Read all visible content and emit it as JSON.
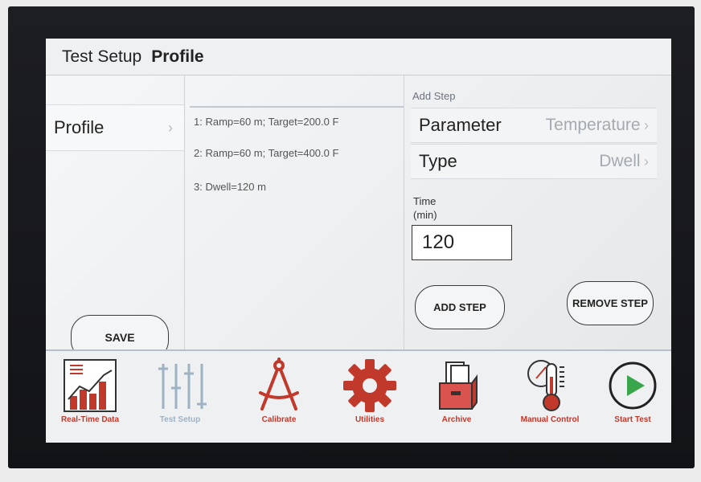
{
  "header": {
    "crumb": "Test Setup",
    "current": "Profile"
  },
  "sidebar": {
    "item_label": "Profile",
    "save_label": "SAVE"
  },
  "steps": [
    "1: Ramp=60 m; Target=200.0 F",
    "2: Ramp=60 m; Target=400.0 F",
    "3: Dwell=120 m"
  ],
  "form": {
    "section_label": "Add Step",
    "parameter_label": "Parameter",
    "parameter_value": "Temperature",
    "type_label": "Type",
    "type_value": "Dwell",
    "time_label_line1": "Time",
    "time_label_line2": "(min)",
    "time_value": "120",
    "add_step_label": "ADD STEP",
    "remove_step_label": "REMOVE STEP"
  },
  "toolbar": {
    "realtime": "Real-Time Data",
    "testsetup": "Test Setup",
    "calibrate": "Calibrate",
    "utilities": "Utilities",
    "archive": "Archive",
    "manual": "Manual Control",
    "start": "Start Test"
  },
  "colors": {
    "accent_red": "#c0392b",
    "green": "#3aa64b",
    "inactive_blue": "#9fb2c4"
  }
}
